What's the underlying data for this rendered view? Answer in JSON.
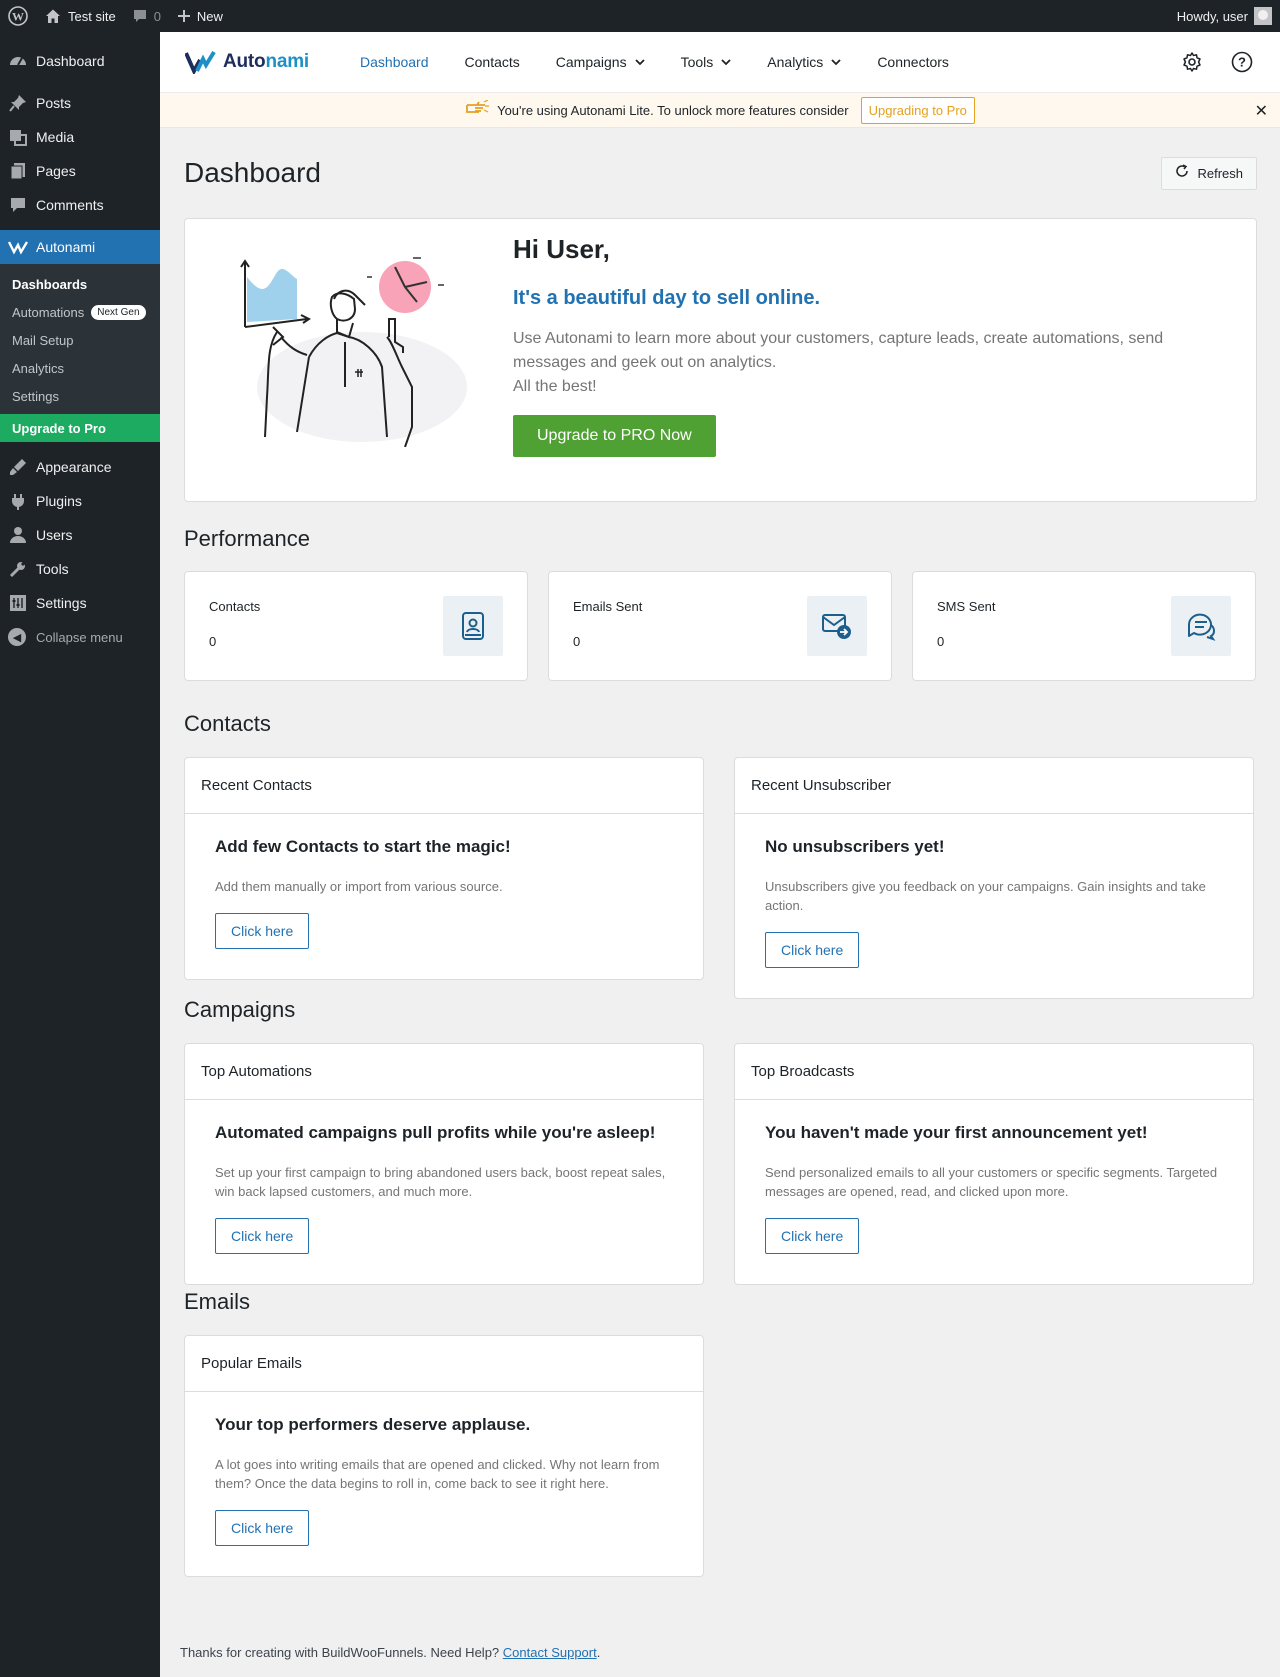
{
  "admin_bar": {
    "site_name": "Test site",
    "comments_count": "0",
    "new_label": "New",
    "howdy": "Howdy, user"
  },
  "sidebar": {
    "items_top": [
      {
        "label": "Dashboard",
        "icon": "dashboard-icon"
      },
      {
        "label": "Posts",
        "icon": "pin-icon"
      },
      {
        "label": "Media",
        "icon": "media-icon"
      },
      {
        "label": "Pages",
        "icon": "pages-icon"
      },
      {
        "label": "Comments",
        "icon": "comment-icon"
      }
    ],
    "active": {
      "label": "Autonami",
      "icon": "autonami-icon"
    },
    "submenu": [
      {
        "label": "Dashboards"
      },
      {
        "label": "Automations",
        "badge": "Next Gen"
      },
      {
        "label": "Mail Setup"
      },
      {
        "label": "Analytics"
      },
      {
        "label": "Settings"
      }
    ],
    "upgrade": "Upgrade to Pro",
    "items_bottom": [
      {
        "label": "Appearance",
        "icon": "brush-icon"
      },
      {
        "label": "Plugins",
        "icon": "plugin-icon"
      },
      {
        "label": "Users",
        "icon": "user-icon"
      },
      {
        "label": "Tools",
        "icon": "wrench-icon"
      },
      {
        "label": "Settings",
        "icon": "settings-icon"
      }
    ],
    "collapse": "Collapse menu"
  },
  "topnav": {
    "logo_a": "Auto",
    "logo_b": "nami",
    "items": [
      {
        "label": "Dashboard",
        "dropdown": false
      },
      {
        "label": "Contacts",
        "dropdown": false
      },
      {
        "label": "Campaigns",
        "dropdown": true
      },
      {
        "label": "Tools",
        "dropdown": true
      },
      {
        "label": "Analytics",
        "dropdown": true
      },
      {
        "label": "Connectors",
        "dropdown": false
      }
    ]
  },
  "notice": {
    "text": "You're using Autonami Lite. To unlock more features consider",
    "button": "Upgrading to Pro",
    "close": "✕"
  },
  "page": {
    "title": "Dashboard",
    "refresh": "Refresh"
  },
  "hero": {
    "greeting": "Hi User,",
    "tagline": "It's a beautiful day to sell online.",
    "body_1": "Use Autonami to learn more about your customers, capture leads, create automations, send messages and geek out on analytics.",
    "body_2": "All the best!",
    "button": "Upgrade to PRO Now"
  },
  "performance": {
    "title": "Performance",
    "cards": [
      {
        "label": "Contacts",
        "value": "0",
        "icon": "contact-book-icon"
      },
      {
        "label": "Emails Sent",
        "value": "0",
        "icon": "email-sent-icon"
      },
      {
        "label": "SMS Sent",
        "value": "0",
        "icon": "chat-icon"
      }
    ]
  },
  "contacts": {
    "title": "Contacts",
    "recent": {
      "head": "Recent Contacts",
      "heading": "Add few Contacts to start the magic!",
      "text": "Add them manually or import from various source.",
      "button": "Click here"
    },
    "unsub": {
      "head": "Recent Unsubscriber",
      "heading": "No unsubscribers yet!",
      "text": "Unsubscribers give you feedback on your campaigns. Gain insights and take action.",
      "button": "Click here"
    }
  },
  "campaigns": {
    "title": "Campaigns",
    "automations": {
      "head": "Top Automations",
      "heading": "Automated campaigns pull profits while you're asleep!",
      "text": "Set up your first campaign to bring abandoned users back, boost repeat sales, win back lapsed customers, and much more.",
      "button": "Click here"
    },
    "broadcasts": {
      "head": "Top Broadcasts",
      "heading": "You haven't made your first announcement yet!",
      "text": "Send personalized emails to all your customers or specific segments. Targeted messages are opened, read, and clicked upon more.",
      "button": "Click here"
    }
  },
  "emails": {
    "title": "Emails",
    "popular": {
      "head": "Popular Emails",
      "heading": "Your top performers deserve applause.",
      "text": "A lot goes into writing emails that are opened and clicked. Why not learn from them? Once the data begins to roll in, come back to see it right here.",
      "button": "Click here"
    }
  },
  "footer": {
    "text": "Thanks for creating with BuildWooFunnels. Need Help?",
    "link": "Contact Support",
    "end": "."
  },
  "colors": {
    "accent": "#2271b1",
    "green": "#4fa133",
    "upgrade_green": "#1daa61",
    "notice_orange": "#e5a022",
    "admin_dark": "#1d2327"
  }
}
